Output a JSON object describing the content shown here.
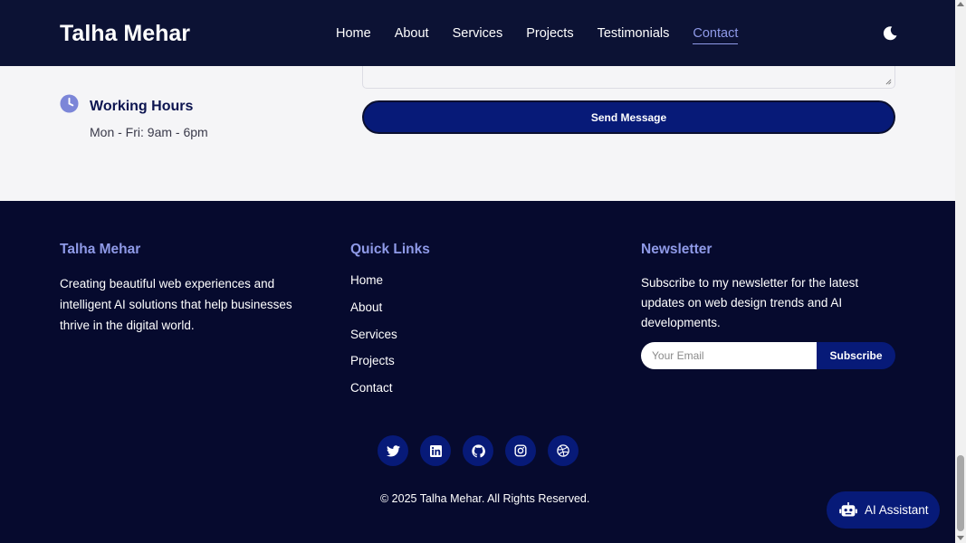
{
  "header": {
    "logo": "Talha Mehar",
    "nav": [
      "Home",
      "About",
      "Services",
      "Projects",
      "Testimonials",
      "Contact"
    ],
    "active_nav": "Contact",
    "theme_icon": "moon-icon"
  },
  "contact": {
    "working_hours_title": "Working Hours",
    "working_hours_text": "Mon - Fri: 9am - 6pm",
    "send_button": "Send Message"
  },
  "footer": {
    "about": {
      "title": "Talha Mehar",
      "text": "Creating beautiful web experiences and intelligent AI solutions that help businesses thrive in the digital world."
    },
    "quick_links": {
      "title": "Quick Links",
      "items": [
        "Home",
        "About",
        "Services",
        "Projects",
        "Contact"
      ]
    },
    "newsletter": {
      "title": "Newsletter",
      "text": "Subscribe to my newsletter for the latest updates on web design trends and AI developments.",
      "placeholder": "Your Email",
      "button": "Subscribe"
    },
    "socials": [
      "twitter-icon",
      "linkedin-icon",
      "github-icon",
      "instagram-icon",
      "dribbble-icon"
    ],
    "copyright": "© 2025 Talha Mehar. All Rights Reserved."
  },
  "ai_assistant": {
    "label": "AI Assistant"
  },
  "colors": {
    "header_bg": "#0c1234",
    "footer_bg": "#060a2e",
    "accent": "#8f9ae8",
    "button_bg": "#071a78"
  }
}
